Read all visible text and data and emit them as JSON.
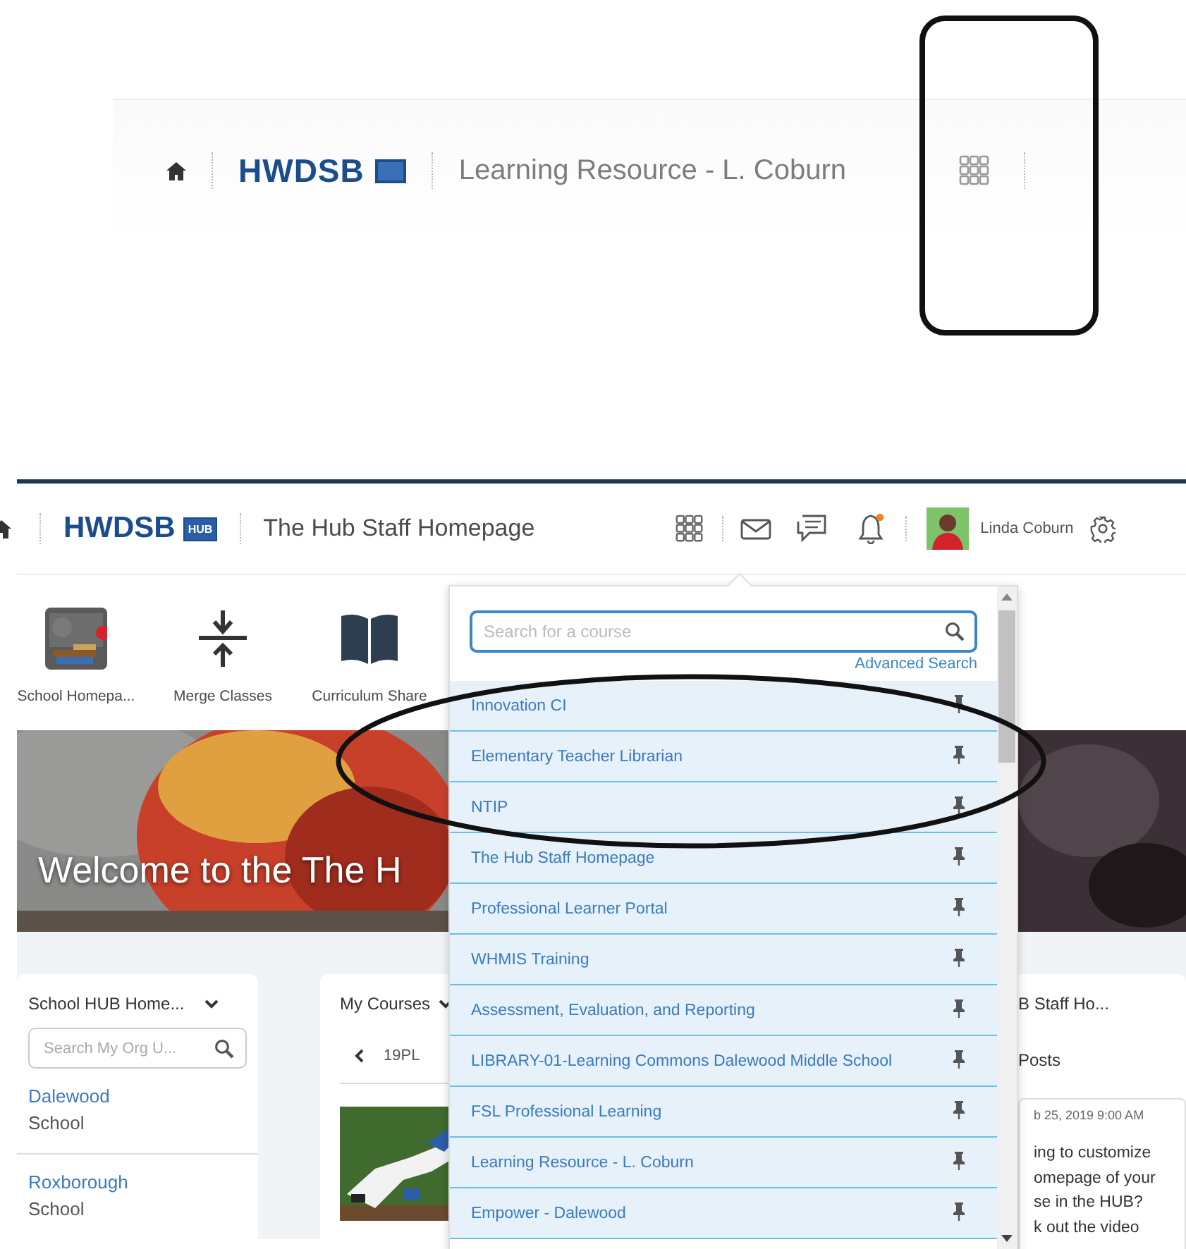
{
  "top_crop": {
    "logo": "HWDSB",
    "title": "Learning Resource - L. Coburn"
  },
  "header": {
    "logo": "HWDSB",
    "logo_badge": "HUB",
    "title": "The Hub Staff Homepage",
    "user_name": "Linda Coburn",
    "notification_dot": true
  },
  "nav_items": [
    {
      "label": "School Homepa...",
      "kind": "picture"
    },
    {
      "label": "Merge Classes",
      "kind": "merge"
    },
    {
      "label": "Curriculum Share",
      "kind": "book"
    }
  ],
  "banner": {
    "heading": "Welcome to the The H"
  },
  "org_widget": {
    "title": "School HUB Home...",
    "search": {
      "placeholder": "Search My Org U..."
    },
    "items": [
      {
        "name": "Dalewood",
        "type": "School"
      },
      {
        "name": "Roxborough",
        "type": "School"
      }
    ]
  },
  "courses_widget": {
    "title": "My Courses",
    "tabs": [
      "19PL"
    ]
  },
  "news_widget": {
    "title": "B Staff Ho...",
    "section": "Posts",
    "post_date": "b 25, 2019 9:00 AM",
    "post_lines": [
      "ing to customize",
      "omepage of your",
      "se in the HUB?",
      "k out the video"
    ]
  },
  "course_menu": {
    "search": {
      "placeholder": "Search for a course"
    },
    "advanced_link": "Advanced Search",
    "courses": [
      {
        "name": "Innovation CI",
        "pinned": true
      },
      {
        "name": "Elementary Teacher Librarian",
        "pinned": true
      },
      {
        "name": "NTIP",
        "pinned": true
      },
      {
        "name": "The Hub Staff Homepage",
        "pinned": true
      },
      {
        "name": "Professional Learner Portal",
        "pinned": true
      },
      {
        "name": "WHMIS Training",
        "pinned": true
      },
      {
        "name": "Assessment, Evaluation, and Reporting",
        "pinned": true
      },
      {
        "name": "LIBRARY-01-Learning Commons Dalewood Middle School",
        "pinned": true
      },
      {
        "name": "FSL Professional Learning",
        "pinned": true
      },
      {
        "name": "Learning Resource - L. Coburn",
        "pinned": true
      },
      {
        "name": "Empower - Dalewood",
        "pinned": true
      }
    ]
  }
}
